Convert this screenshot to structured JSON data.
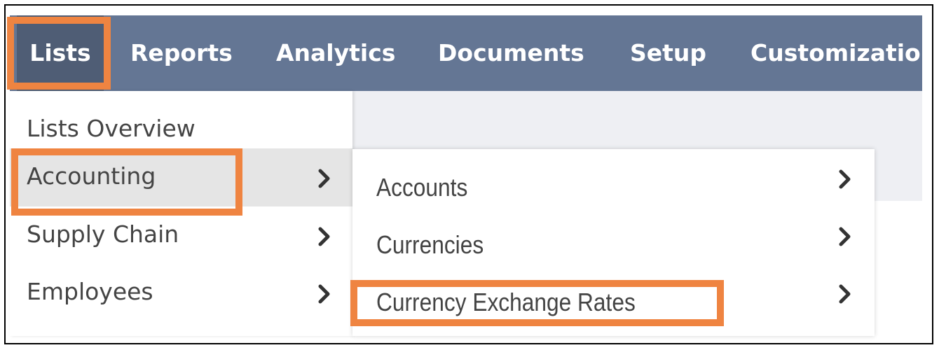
{
  "navbar": {
    "items": [
      {
        "label": "Lists",
        "active": true
      },
      {
        "label": "Reports"
      },
      {
        "label": "Analytics"
      },
      {
        "label": "Documents"
      },
      {
        "label": "Setup"
      },
      {
        "label": "Customization"
      }
    ]
  },
  "lists_menu": {
    "items": [
      {
        "label": "Lists Overview",
        "has_submenu": false
      },
      {
        "label": "Accounting",
        "has_submenu": true,
        "hovered": true
      },
      {
        "label": "Supply Chain",
        "has_submenu": true
      },
      {
        "label": "Employees",
        "has_submenu": true
      }
    ]
  },
  "accounting_submenu": {
    "items": [
      {
        "label": "Accounts",
        "has_submenu": true
      },
      {
        "label": "Currencies",
        "has_submenu": true
      },
      {
        "label": "Currency Exchange Rates",
        "has_submenu": true
      }
    ]
  },
  "icons": {
    "submenu_arrow": "chevron-right-icon"
  },
  "colors": {
    "navbar": "#647694",
    "navbar_active": "#4f5d75",
    "highlight_outline": "#ef8441",
    "hover_row": "#e5e5e5",
    "content_bg": "#eeeff3",
    "menu_text": "#444444"
  }
}
